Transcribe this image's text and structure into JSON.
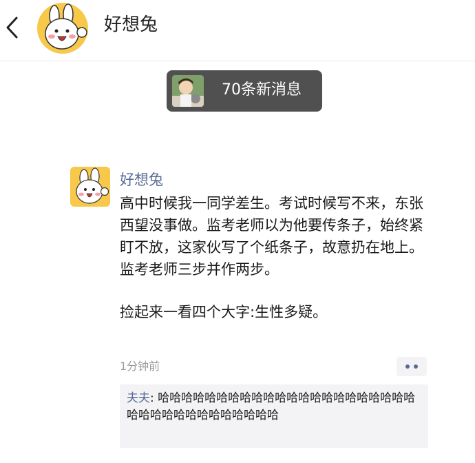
{
  "header": {
    "title": "好想兔",
    "back_icon": "chevron-left-icon"
  },
  "new_messages": {
    "label": "70条新消息"
  },
  "post": {
    "author": "好想兔",
    "paragraphs": [
      "高中时候我一同学差生。考试时候写不来，东张西望没事做。监考老师以为他要传条子，始终紧盯不放，这家伙写了个纸条子，故意扔在地上。监考老师三步并作两步。",
      "捡起来一看四个大字:生性多疑。"
    ],
    "time": "1分钟前",
    "more_icon": "more-dots-icon"
  },
  "comment": {
    "user": "夫夫",
    "separator": ": ",
    "text": "哈哈哈哈哈哈哈哈哈哈哈哈哈哈哈哈哈哈哈哈哈哈哈哈哈哈哈哈哈哈哈哈哈哈哈"
  },
  "colors": {
    "link_blue": "#576b95",
    "pill_bg": "#505050",
    "comment_bg": "#f3f3f5",
    "avatar_yellow": "#f7c84a"
  }
}
